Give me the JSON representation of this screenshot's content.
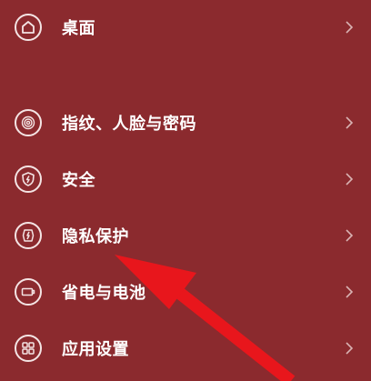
{
  "settings_list": {
    "items": [
      {
        "label": "桌面",
        "icon": "home-icon"
      },
      {
        "label": "指纹、人脸与密码",
        "icon": "fingerprint-icon"
      },
      {
        "label": "安全",
        "icon": "shield-icon"
      },
      {
        "label": "隐私保护",
        "icon": "privacy-icon"
      },
      {
        "label": "省电与电池",
        "icon": "battery-icon"
      },
      {
        "label": "应用设置",
        "icon": "apps-grid-icon"
      }
    ]
  },
  "colors": {
    "background": "#8b2a2e",
    "icon_stroke": "#f4e4e4",
    "text": "#ffffff",
    "chevron": "#d9b3b3",
    "annotation_arrow": "#e8161c"
  },
  "annotation": {
    "type": "red-arrow",
    "points_to": "隐私保护"
  }
}
